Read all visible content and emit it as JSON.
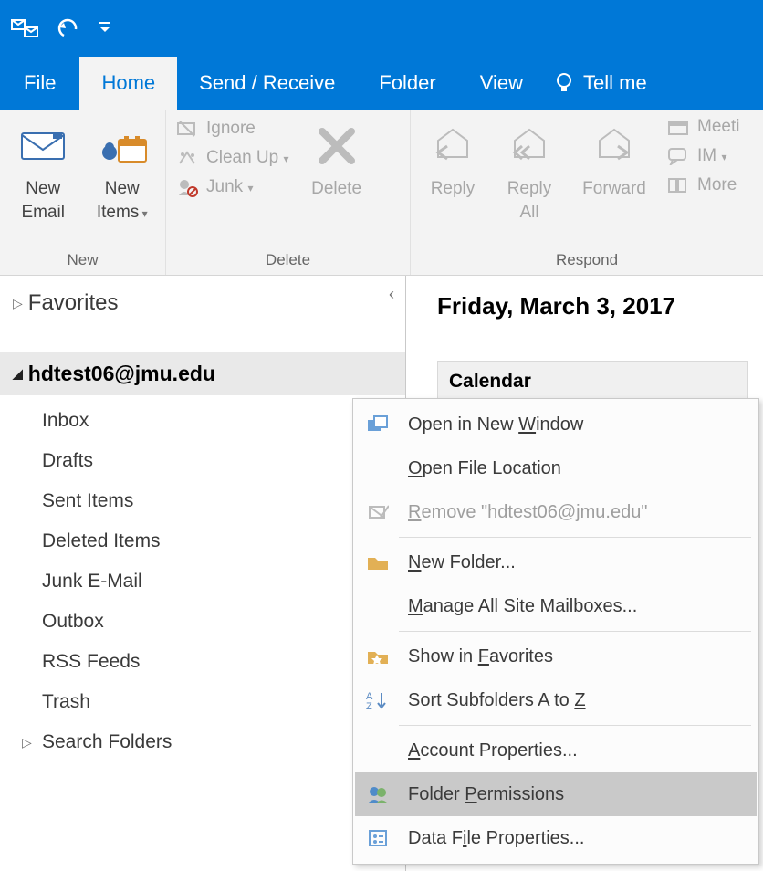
{
  "ribbon_tabs": {
    "file": "File",
    "home": "Home",
    "send_receive": "Send / Receive",
    "folder": "Folder",
    "view": "View",
    "tell_me": "Tell me"
  },
  "ribbon": {
    "new": {
      "group_label": "New",
      "new_email": "New Email",
      "new_items": "New Items"
    },
    "delete": {
      "group_label": "Delete",
      "ignore": "Ignore",
      "clean_up": "Clean Up",
      "junk": "Junk",
      "delete": "Delete"
    },
    "respond": {
      "group_label": "Respond",
      "reply": "Reply",
      "reply_all": "Reply All",
      "forward": "Forward",
      "meeting": "Meeti",
      "im": "IM",
      "more": "More"
    }
  },
  "sidebar": {
    "favorites": "Favorites",
    "account": "hdtest06@jmu.edu",
    "folders": {
      "inbox": "Inbox",
      "drafts": "Drafts",
      "sent": "Sent Items",
      "deleted": "Deleted Items",
      "junk": "Junk E-Mail",
      "outbox": "Outbox",
      "rss": "RSS Feeds",
      "trash": "Trash",
      "search": "Search Folders"
    }
  },
  "reading": {
    "date": "Friday, March 3, 2017",
    "calendar": "Calendar"
  },
  "context_menu": {
    "open_window_pre": "Open in New ",
    "open_window_mn": "W",
    "open_window_post": "indow",
    "open_location_mn": "O",
    "open_location_post": "pen File Location",
    "remove_mn": "R",
    "remove_post": "emove \"hdtest06@jmu.edu\"",
    "new_folder_mn": "N",
    "new_folder_post": "ew Folder...",
    "manage_mn": "M",
    "manage_post": "anage All Site Mailboxes...",
    "favorites_pre": "Show in ",
    "favorites_mn": "F",
    "favorites_post": "avorites",
    "sort_pre": "Sort Subfolders A to ",
    "sort_mn": "Z",
    "account_props_mn": "A",
    "account_props_post": "ccount Properties...",
    "folder_perm_pre": "Folder ",
    "folder_perm_mn": "P",
    "folder_perm_post": "ermissions",
    "data_file_mn": "i",
    "data_file_pre": "Data F",
    "data_file_post": "le Properties..."
  }
}
